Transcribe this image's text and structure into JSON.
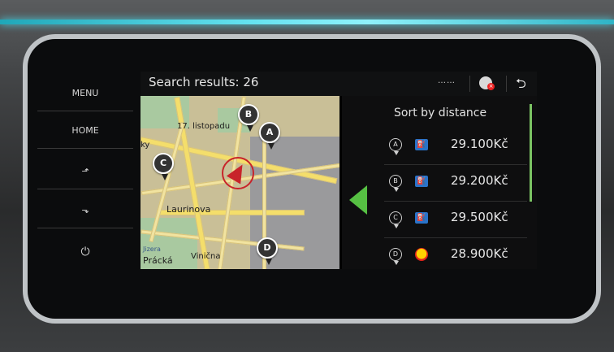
{
  "hardware_buttons": [
    "MENU",
    "HOME",
    "⬏",
    "⬎",
    "⏻"
  ],
  "topbar": {
    "title": "Search results: 26",
    "signal_text": "……",
    "back_glyph": "⮌"
  },
  "map": {
    "labels": [
      "17. listopadu",
      "ky",
      "Laurinova",
      "Jizera",
      "Prácká",
      "Vinična"
    ],
    "pins": [
      "A",
      "B",
      "C",
      "D"
    ]
  },
  "results": {
    "sort_label": "Sort by distance",
    "items": [
      {
        "marker": "A",
        "brand_icon": "fuel-station-icon",
        "price": "29.100Kč"
      },
      {
        "marker": "B",
        "brand_icon": "fuel-station-icon",
        "price": "29.200Kč"
      },
      {
        "marker": "C",
        "brand_icon": "fuel-station-icon",
        "price": "29.500Kč"
      },
      {
        "marker": "D",
        "brand_icon": "shell-icon",
        "price": "28.900Kč"
      }
    ]
  },
  "colors": {
    "ambient": "#63e1ef",
    "accent_green": "#56c043",
    "position_red": "#c8242a"
  }
}
